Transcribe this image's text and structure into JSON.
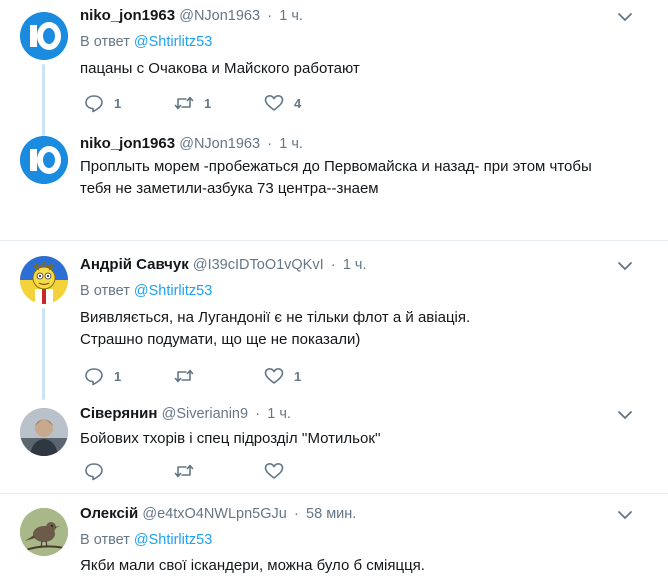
{
  "tweets": [
    {
      "name": "niko_jon1963",
      "handle": "@NJon1963",
      "dot": "·",
      "time": "1 ч.",
      "reply_prefix": "В ответ",
      "reply_to": "@Shtirlitz53",
      "text": "пацаны с Очакова и Майского работают",
      "replies": "1",
      "retweets": "1",
      "likes": "4",
      "avatar": "channel-10-logo"
    },
    {
      "name": "niko_jon1963",
      "handle": "@NJon1963",
      "dot": "·",
      "time": "1 ч.",
      "text_line1": "Проплыть морем -пробежаться до Первомайска и назад- при этом чтобы",
      "text_line2": "тебя не заметили-азбука 73 центра--знаем",
      "avatar": "channel-10-logo"
    },
    {
      "name": "Андрій Савчук",
      "handle": "@I39cIDToO1vQKvI",
      "dot": "·",
      "time": "1 ч.",
      "reply_prefix": "В ответ",
      "reply_to": "@Shtirlitz53",
      "text_line1": "Виявляється, на Лугандонії є не тільки флот а й авіація.",
      "text_line2": "Страшно подумати, що ще не показали)",
      "replies": "1",
      "retweets": "",
      "likes": "1",
      "avatar": "cartoon-avatar"
    },
    {
      "name": "Сіверянин",
      "handle": "@Siverianin9",
      "dot": "·",
      "time": "1 ч.",
      "text": "Бойових тхорів і спец підрозділ ''Мотильок''",
      "replies": "",
      "retweets": "",
      "likes": "",
      "avatar": "portrait-avatar"
    },
    {
      "name": "Олексій",
      "handle": "@e4txO4NWLpn5GJu",
      "dot": "·",
      "time": "58 мин.",
      "reply_prefix": "В ответ",
      "reply_to": "@Shtirlitz53",
      "text": "Якби мали свої іскандери, можна було б сміяцця.",
      "avatar": "bird-avatar"
    }
  ],
  "colors": {
    "accent": "#1da1f2",
    "muted": "#657786",
    "text": "#14171a",
    "divider": "#e6ecf0",
    "thread_line": "#cce4f6",
    "ten_logo": "#1d8fe0"
  }
}
